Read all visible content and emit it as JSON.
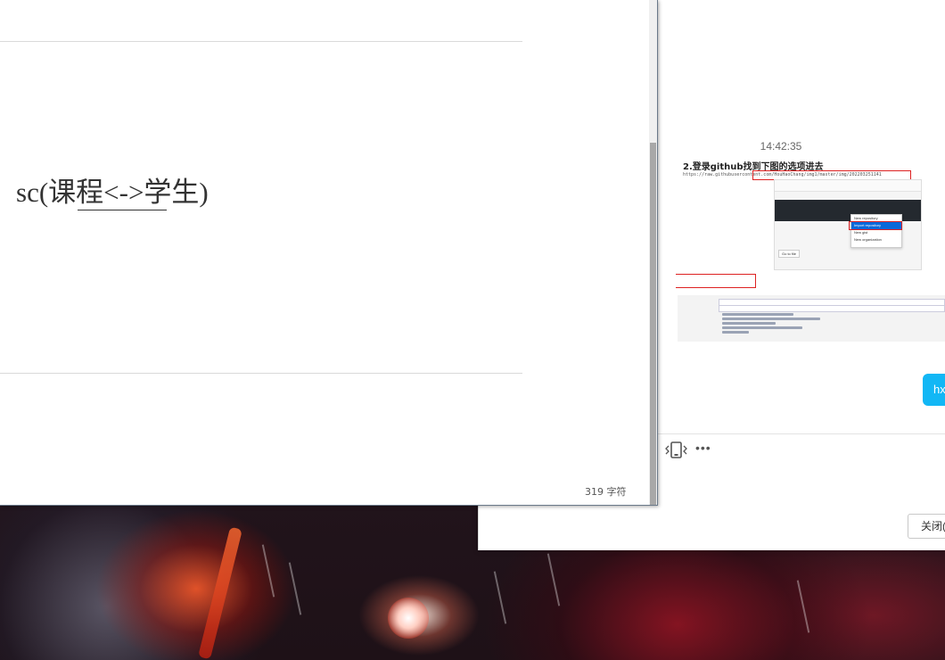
{
  "document": {
    "content_text": "sc(课程<->学生)",
    "word_count": "319 字符"
  },
  "chat": {
    "timestamp": "14:42:35",
    "image_title": "2.登录github找到下图的选项进去",
    "image_url_text": "https://raw.githubusercontent.com/HouHaoChang/img1/master/img/202203251141",
    "menu_items": [
      "New repository",
      "Import repository",
      "New gist",
      "New organization"
    ],
    "go_to_file": "Go to file",
    "bubble_text": "hx",
    "more_icon": "more-dots-icon",
    "close_label": "关闭("
  }
}
